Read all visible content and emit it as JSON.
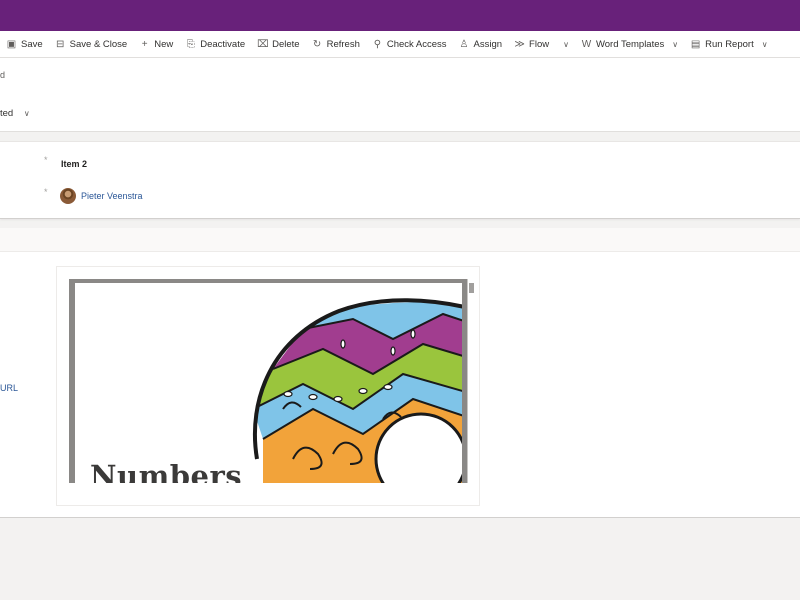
{
  "colors": {
    "brand_bar": "#68217a",
    "link": "#2b5797"
  },
  "toolbar": {
    "items": [
      {
        "label": "Save",
        "icon": "save-icon",
        "glyph": "▣"
      },
      {
        "label": "Save & Close",
        "icon": "save-close-icon",
        "glyph": "⊟"
      },
      {
        "label": "New",
        "icon": "plus-icon",
        "glyph": "+"
      },
      {
        "label": "Deactivate",
        "icon": "deactivate-icon",
        "glyph": "⎘"
      },
      {
        "label": "Delete",
        "icon": "trash-icon",
        "glyph": "🗑"
      },
      {
        "label": "Refresh",
        "icon": "refresh-icon",
        "glyph": "↻"
      },
      {
        "label": "Check Access",
        "icon": "check-access-icon",
        "glyph": "⚲"
      },
      {
        "label": "Assign",
        "icon": "person-icon",
        "glyph": "♙"
      },
      {
        "label": "Flow",
        "icon": "flow-icon",
        "glyph": "≫"
      },
      {
        "label": "Word Templates",
        "icon": "word-icon",
        "glyph": "W"
      },
      {
        "label": "Run Report",
        "icon": "report-icon",
        "glyph": "▤"
      }
    ],
    "chevron": "∨"
  },
  "header": {
    "fragment_1": "d",
    "fragment_2": "ted"
  },
  "form": {
    "required_marker": "*",
    "name_value": "Item 2",
    "owner_name": "Pieter Veenstra"
  },
  "preview_section": {
    "url_fragment": "URL",
    "document_title": "Numbers"
  }
}
